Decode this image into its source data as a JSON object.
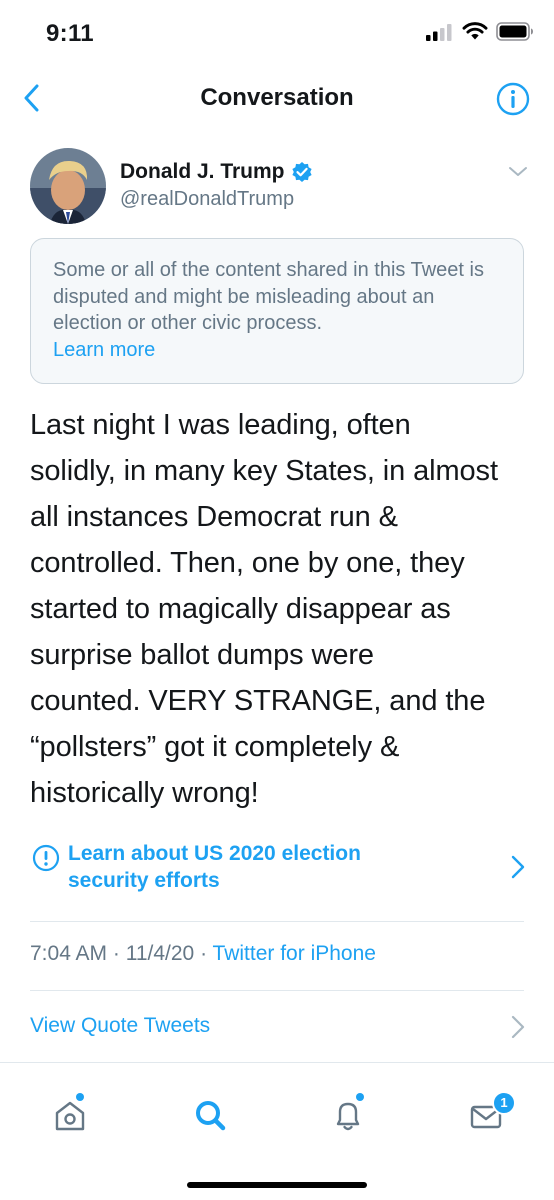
{
  "status_bar": {
    "time": "9:11"
  },
  "nav": {
    "title": "Conversation"
  },
  "author": {
    "name": "Donald J. Trump",
    "handle": "@realDonaldTrump"
  },
  "notice": {
    "text": "Some or all of the content shared in this Tweet is disputed and might be misleading about an election or other civic process.",
    "link": "Learn more"
  },
  "tweet": {
    "lines": [
      "Last night I was leading, often",
      "solidly, in many key States, in almost",
      "all instances Democrat run &",
      "controlled. Then, one by one, they",
      "started to magically disappear as",
      "surprise ballot dumps were",
      "counted. VERY STRANGE, and the",
      "“pollsters” got it completely &",
      "historically wrong!"
    ]
  },
  "election_link": {
    "line1": "Learn about US 2020 election",
    "line2": "security efforts"
  },
  "meta": {
    "time": "7:04 AM",
    "sep1": " · ",
    "date": "11/4/20",
    "sep2": " · ",
    "source": "Twitter for iPhone"
  },
  "quote_tweets": {
    "label": "View Quote Tweets"
  },
  "tab_bar": {
    "messages_badge": "1"
  },
  "colors": {
    "accent": "#1da1f2",
    "secondary_text": "#657786",
    "divider": "#e1e8ed",
    "notice_bg": "#f5f8fa"
  }
}
